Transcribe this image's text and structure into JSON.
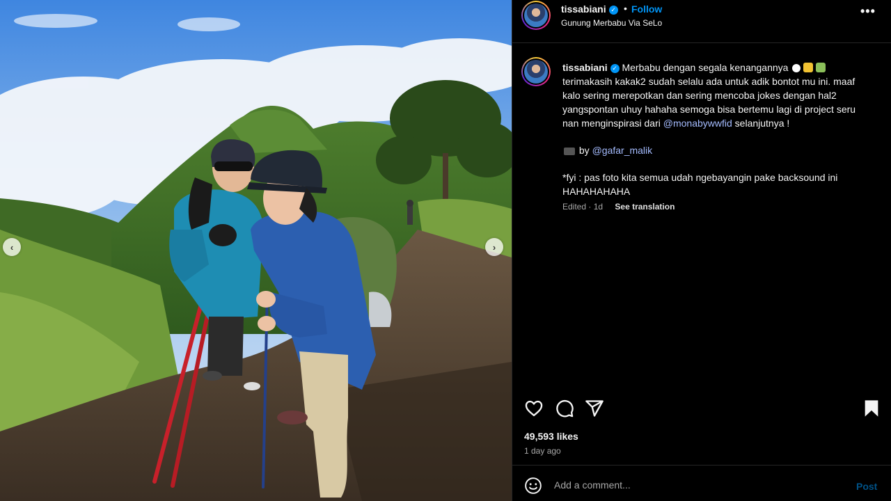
{
  "post": {
    "username": "tissabiani",
    "verified": true,
    "header_separator": "•",
    "follow_label": "Follow",
    "location": "Gunung Merbabu Via SeLo",
    "more_icon": "more-horizontal-icon"
  },
  "caption": {
    "username": "tissabiani",
    "line1": "Merbabu dengan segala kenangannya",
    "line2": "terimakasih kakak2 sudah selalu ada untuk adik bontot mu ini. maaf kalo sering merepotkan dan sering mencoba jokes dengan hal2 yangspontan uhuy hahaha semoga bisa bertemu lagi di project seru nan menginspirasi dari",
    "mention1": "@monabywwfid",
    "line2_end": "selanjutnya !",
    "by_label": "by",
    "mention2": "@gafar_malik",
    "fyi": "*fyi : pas foto kita semua udah ngebayangin pake backsound ini HAHAHAHAHA",
    "edited": "Edited · 1d",
    "see_translation": "See translation"
  },
  "actions": {
    "like_icon": "heart-icon",
    "comment_icon": "comment-icon",
    "share_icon": "send-icon",
    "save_icon": "bookmark-icon"
  },
  "likes": "49,593 likes",
  "timestamp": "1 day ago",
  "comment": {
    "placeholder": "Add a comment...",
    "post_label": "Post"
  },
  "carousel": {
    "prev_icon": "chevron-left-icon",
    "next_icon": "chevron-right-icon",
    "prev_glyph": "‹",
    "next_glyph": "›"
  },
  "colors": {
    "background": "#000000",
    "link_blue": "#0095f6",
    "mention": "#a5bcff",
    "muted_text": "#a8a8a8"
  }
}
